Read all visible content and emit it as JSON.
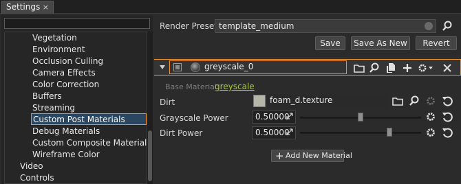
{
  "tab": {
    "title": "Settings",
    "close": "×"
  },
  "tree": {
    "items": [
      "Vegetation",
      "Environment",
      "Occlusion Culling",
      "Camera Effects",
      "Color Correction",
      "Buffers",
      "Streaming",
      "Custom Post Materials",
      "Debug Materials",
      "Custom Composite Materials",
      "Wireframe Color"
    ],
    "selected": "Custom Post Materials",
    "root_items": [
      "Video",
      "Controls"
    ]
  },
  "render_preset": {
    "label": "Render Preset:",
    "value": "template_medium"
  },
  "buttons": {
    "save": "Save",
    "save_as_new": "Save As New",
    "revert": "Revert"
  },
  "material": {
    "name": "greyscale_0",
    "base_label": "Base Material:",
    "base_value": "greyscale"
  },
  "params": {
    "dirt": {
      "label": "Dirt",
      "value": "foam_d.texture"
    },
    "grayscale_power": {
      "label": "Grayscale Power",
      "value": "0.50000",
      "level": 0.5
    },
    "dirt_power": {
      "label": "Dirt Power",
      "value": "0.50000",
      "level": 0.7
    }
  },
  "add_material": {
    "label": "Add New Material"
  },
  "colors": {
    "accent": "#f0902a",
    "link": "#a8cc3a",
    "selection": "#2b4660"
  }
}
